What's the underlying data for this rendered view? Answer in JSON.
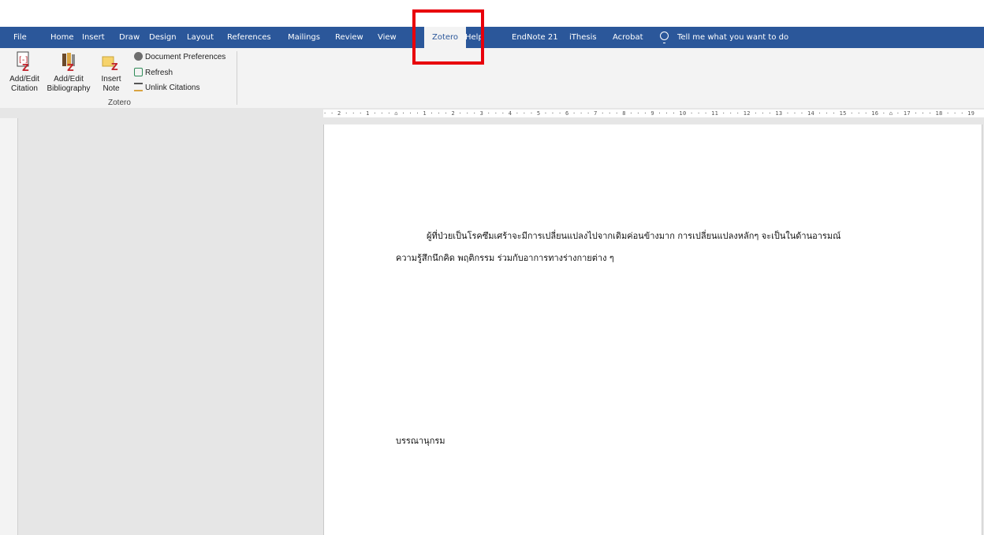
{
  "menubar": {
    "tabs": [
      "File",
      "Home",
      "Insert",
      "Draw",
      "Design",
      "Layout",
      "References",
      "Mailings",
      "Review",
      "View",
      "Zotero",
      "Help",
      "EndNote 21",
      "iThesis",
      "Acrobat"
    ],
    "active_tab": "Zotero",
    "tell_me": "Tell me what you want to do"
  },
  "ribbon": {
    "add_edit_citation": "Add/Edit\nCitation",
    "add_edit_bibliography": "Add/Edit\nBibliography",
    "insert_note": "Insert\nNote",
    "document_preferences": "Document Preferences",
    "refresh": "Refresh",
    "unlink_citations": "Unlink Citations",
    "group_label": "Zotero"
  },
  "ruler": {
    "text": "· · 2 · · · 1 · · · ⌂ · · · 1 · · · 2 · · · 3 · · · 4 · · · 5 · · · 6 · · · 7 · · · 8 · · · 9 · · · 10 · · · 11 · · · 12 · · · 13 · · · 14 · · · 15 · · · 16 · ⌂ · 17 · · · 18 · · · 19"
  },
  "document": {
    "line1": "ผู้ที่ป่วยเป็นโรคซึมเศร้าจะมีการเปลี่ยนแปลงไปจากเดิมค่อนข้างมาก การเปลี่ยนแปลงหลักๆ จะเป็นในด้านอารมณ์",
    "line2": "ความรู้สึกนึกคิด พฤติกรรม ร่วมกับอาการทางร่างกายต่าง ๆ",
    "bibliography_heading": "บรรณานุกรม"
  },
  "colors": {
    "menubar_bg": "#2b579a",
    "highlight": "#e8000b",
    "zotero_red": "#c0262d"
  }
}
